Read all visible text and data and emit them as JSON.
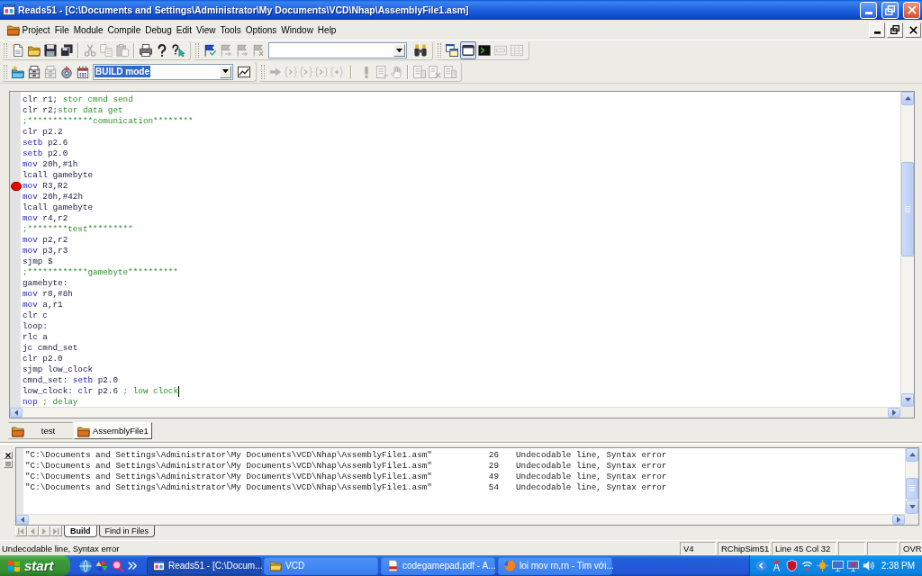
{
  "window": {
    "title": "Reads51 - [C:\\Documents and Settings\\Administrator\\My Documents\\VCD\\Nhap\\AssemblyFile1.asm]"
  },
  "menu": [
    "Project",
    "File",
    "Module",
    "Compile",
    "Debug",
    "Edit",
    "View",
    "Tools",
    "Options",
    "Window",
    "Help"
  ],
  "toolbar_1": {
    "file_buttons": [
      {
        "disabled": false
      },
      {
        "disabled": false
      },
      {
        "disabled": false
      },
      {
        "disabled": false
      }
    ],
    "edit_buttons": [
      {
        "disabled": true
      },
      {
        "disabled": true
      },
      {
        "disabled": true
      }
    ],
    "help_buttons": [
      {
        "disabled": false
      },
      {
        "disabled": false
      },
      {
        "disabled": false
      }
    ],
    "bookmark_buttons": [
      {
        "disabled": false
      },
      {
        "disabled": true
      },
      {
        "disabled": true
      },
      {
        "disabled": true
      }
    ],
    "window_buttons": [
      {
        "disabled": false,
        "pressed": false
      },
      {
        "disabled": false,
        "pressed": true
      },
      {
        "disabled": false,
        "pressed": false
      },
      {
        "disabled": true,
        "pressed": false
      },
      {
        "disabled": true,
        "pressed": false
      }
    ]
  },
  "toolbar_2": {
    "project_buttons": [
      {
        "disabled": false
      },
      {
        "disabled": false
      },
      {
        "disabled": true
      },
      {
        "disabled": false
      },
      {
        "disabled": false
      }
    ],
    "build_mode": {
      "value": "BUILD mode",
      "highlighted": true
    },
    "debug_buttons": [
      {
        "disabled": true
      },
      {
        "disabled": true
      },
      {
        "disabled": true
      },
      {
        "disabled": true
      },
      {
        "disabled": true
      }
    ],
    "run_buttons": [
      {
        "disabled": true
      },
      {
        "disabled": true
      },
      {
        "disabled": true
      }
    ],
    "view_buttons": [
      {
        "disabled": true
      },
      {
        "disabled": true
      },
      {
        "disabled": true
      }
    ]
  },
  "editor": {
    "lines": [
      {
        "breakpoint": false,
        "tokens": [
          {
            "kind": "plain",
            "text": "clr r1;"
          },
          {
            "kind": "comment",
            "text": " stor cmnd send"
          }
        ]
      },
      {
        "breakpoint": false,
        "tokens": [
          {
            "kind": "plain",
            "text": "clr r2;"
          },
          {
            "kind": "comment",
            "text": "stor data get"
          }
        ]
      },
      {
        "breakpoint": false,
        "tokens": [
          {
            "kind": "comment",
            "text": ";*************comunication********"
          }
        ]
      },
      {
        "breakpoint": false,
        "tokens": [
          {
            "kind": "plain",
            "text": "clr p2.2"
          }
        ]
      },
      {
        "breakpoint": false,
        "tokens": [
          {
            "kind": "keyword",
            "text": "setb"
          },
          {
            "kind": "plain",
            "text": " p2.6"
          }
        ]
      },
      {
        "breakpoint": false,
        "tokens": [
          {
            "kind": "keyword",
            "text": "setb"
          },
          {
            "kind": "plain",
            "text": " p2.0"
          }
        ]
      },
      {
        "breakpoint": false,
        "tokens": [
          {
            "kind": "keyword",
            "text": "mov"
          },
          {
            "kind": "plain",
            "text": " 20h,#1h"
          }
        ]
      },
      {
        "breakpoint": false,
        "tokens": [
          {
            "kind": "plain",
            "text": "lcall gamebyte"
          }
        ]
      },
      {
        "breakpoint": true,
        "tokens": [
          {
            "kind": "keyword",
            "text": "mov"
          },
          {
            "kind": "plain",
            "text": " R3,R2"
          }
        ]
      },
      {
        "breakpoint": false,
        "tokens": [
          {
            "kind": "keyword",
            "text": "mov"
          },
          {
            "kind": "plain",
            "text": " 20h,#42h"
          }
        ]
      },
      {
        "breakpoint": false,
        "tokens": [
          {
            "kind": "plain",
            "text": "lcall gamebyte"
          }
        ]
      },
      {
        "breakpoint": false,
        "tokens": [
          {
            "kind": "keyword",
            "text": "mov"
          },
          {
            "kind": "plain",
            "text": " r4,r2"
          }
        ]
      },
      {
        "breakpoint": false,
        "tokens": [
          {
            "kind": "comment",
            "text": ";********test*********"
          }
        ]
      },
      {
        "breakpoint": false,
        "tokens": [
          {
            "kind": "keyword",
            "text": "mov"
          },
          {
            "kind": "plain",
            "text": " p2,r2"
          }
        ]
      },
      {
        "breakpoint": false,
        "tokens": [
          {
            "kind": "keyword",
            "text": "mov"
          },
          {
            "kind": "plain",
            "text": " p3,r3"
          }
        ]
      },
      {
        "breakpoint": false,
        "tokens": [
          {
            "kind": "plain",
            "text": "sjmp $"
          }
        ]
      },
      {
        "breakpoint": false,
        "tokens": [
          {
            "kind": "comment",
            "text": ";************gamebyte**********"
          }
        ]
      },
      {
        "breakpoint": false,
        "tokens": [
          {
            "kind": "plain",
            "text": "gamebyte:"
          }
        ]
      },
      {
        "breakpoint": false,
        "tokens": [
          {
            "kind": "keyword",
            "text": "mov"
          },
          {
            "kind": "plain",
            "text": " r0,#8h"
          }
        ]
      },
      {
        "breakpoint": false,
        "tokens": [
          {
            "kind": "keyword",
            "text": "mov"
          },
          {
            "kind": "plain",
            "text": " a,r1"
          }
        ]
      },
      {
        "breakpoint": false,
        "tokens": [
          {
            "kind": "plain",
            "text": "clr c"
          }
        ]
      },
      {
        "breakpoint": false,
        "tokens": [
          {
            "kind": "plain",
            "text": "loop:"
          }
        ]
      },
      {
        "breakpoint": false,
        "tokens": [
          {
            "kind": "plain",
            "text": "rlc a"
          }
        ]
      },
      {
        "breakpoint": false,
        "tokens": [
          {
            "kind": "plain",
            "text": "jc cmnd_set"
          }
        ]
      },
      {
        "breakpoint": false,
        "tokens": [
          {
            "kind": "plain",
            "text": "clr p2.0"
          }
        ]
      },
      {
        "breakpoint": false,
        "tokens": [
          {
            "kind": "plain",
            "text": "sjmp low_clock"
          }
        ]
      },
      {
        "breakpoint": false,
        "tokens": [
          {
            "kind": "plain",
            "text": "cmnd_set: "
          },
          {
            "kind": "keyword",
            "text": "setb"
          },
          {
            "kind": "plain",
            "text": " p2.0"
          }
        ]
      },
      {
        "breakpoint": false,
        "tokens": [
          {
            "kind": "plain",
            "text": "low_clock: "
          },
          {
            "kind": "keyword",
            "text": "clr"
          },
          {
            "kind": "plain",
            "text": " p2.6 "
          },
          {
            "kind": "comment",
            "text": "; low clock"
          },
          {
            "kind": "caret"
          }
        ]
      },
      {
        "breakpoint": false,
        "tokens": [
          {
            "kind": "keyword",
            "text": "nop"
          },
          {
            "kind": "comment",
            "text": " ; delay"
          }
        ]
      }
    ]
  },
  "file_tabs": [
    {
      "label": "test",
      "selected": false
    },
    {
      "label": "AssemblyFile1",
      "selected": true
    }
  ],
  "output": {
    "rows": [
      {
        "file": "\"C:\\Documents and Settings\\Administrator\\My Documents\\VCD\\Nhap\\AssemblyFile1.asm\"",
        "line": "26",
        "message": "Undecodable line, Syntax error"
      },
      {
        "file": "\"C:\\Documents and Settings\\Administrator\\My Documents\\VCD\\Nhap\\AssemblyFile1.asm\"",
        "line": "29",
        "message": "Undecodable line, Syntax error"
      },
      {
        "file": "\"C:\\Documents and Settings\\Administrator\\My Documents\\VCD\\Nhap\\AssemblyFile1.asm\"",
        "line": "49",
        "message": "Undecodable line, Syntax error"
      },
      {
        "file": "\"C:\\Documents and Settings\\Administrator\\My Documents\\VCD\\Nhap\\AssemblyFile1.asm\"",
        "line": "54",
        "message": "Undecodable line, Syntax error"
      }
    ],
    "tab_scroll_buttons": [
      {
        "disabled": true
      },
      {
        "disabled": true
      },
      {
        "disabled": true
      },
      {
        "disabled": true
      }
    ],
    "tabs": [
      {
        "label": "Build",
        "selected": true
      },
      {
        "label": "Find in Files",
        "selected": false
      }
    ]
  },
  "status_bar": {
    "message": "Undecodable line, Syntax error",
    "version": "V4",
    "target": "RChipSim51",
    "position": "Line 45 Col 32",
    "mode": "OVR"
  },
  "taskbar": {
    "start": "start",
    "tasks": [
      {
        "label": "Reads51 - [C:\\Docum...",
        "selected": true
      },
      {
        "label": "VCD",
        "selected": false
      },
      {
        "label": "codegamepad.pdf - A...",
        "selected": false
      },
      {
        "label": "loi mov rn,rn - Tim với...",
        "selected": false
      }
    ],
    "clock": "2:38 PM"
  }
}
